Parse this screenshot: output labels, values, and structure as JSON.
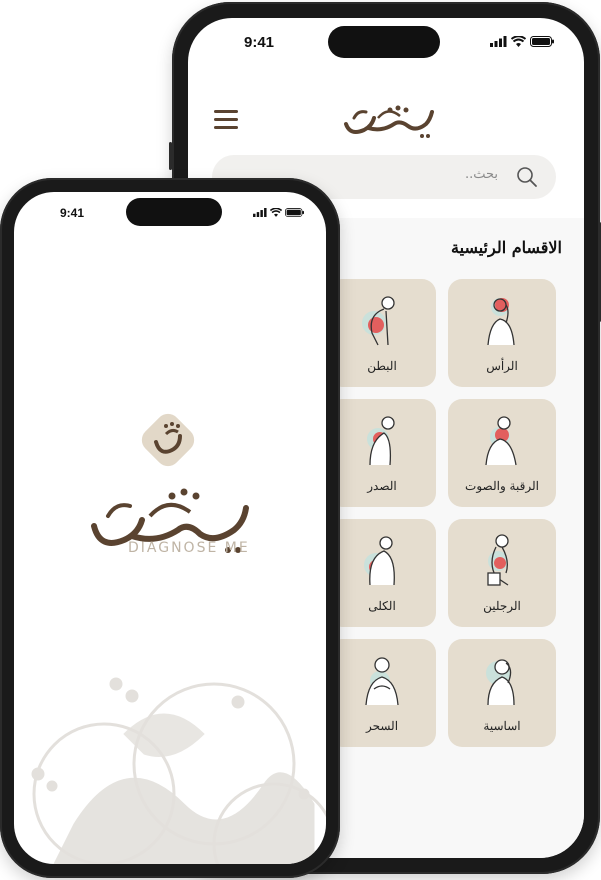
{
  "back_phone": {
    "status_time": "9:41",
    "header": {
      "logo_alt": "شخصني"
    },
    "search": {
      "placeholder": "بحث.."
    },
    "section_title": "الاقسام الرئيسية",
    "categories": [
      {
        "label": "الرأس"
      },
      {
        "label": "البطن"
      },
      {
        "label": "الرقبة والصوت"
      },
      {
        "label": "الصدر"
      },
      {
        "label": "الرجلين"
      },
      {
        "label": "الكلى"
      },
      {
        "label": "اساسية"
      },
      {
        "label": "السحر"
      }
    ]
  },
  "front_phone": {
    "status_time": "9:41",
    "logo_text": "شخصني",
    "tagline": "DIAGNOSE ME"
  },
  "colors": {
    "brand_brown": "#5a4330",
    "card_bg": "#e5ddcf",
    "accent_red": "#e64848",
    "accent_teal": "#bfe3df"
  }
}
